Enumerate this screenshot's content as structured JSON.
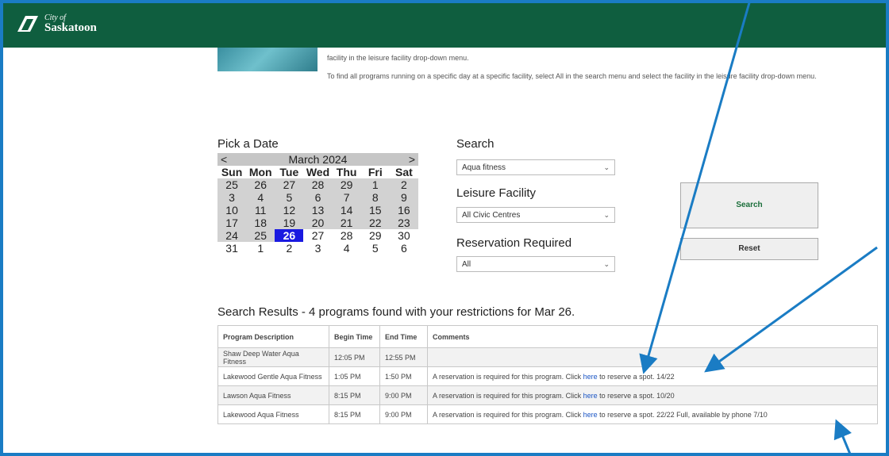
{
  "header": {
    "logo_small": "City of",
    "logo_big": "Saskatoon",
    "brand_color": "#0f5e3f"
  },
  "intro": {
    "line1": "facility in the leisure facility drop-down menu.",
    "line2": "To find all programs running on a specific day at a specific facility, select All in the search menu and select the facility in the leisure facility drop-down menu."
  },
  "calendar": {
    "title": "Pick a Date",
    "prev": "<",
    "next": ">",
    "month": "March 2024",
    "days": [
      "Sun",
      "Mon",
      "Tue",
      "Wed",
      "Thu",
      "Fri",
      "Sat"
    ],
    "weeks": [
      [
        "25",
        "26",
        "27",
        "28",
        "29",
        "1",
        "2"
      ],
      [
        "3",
        "4",
        "5",
        "6",
        "7",
        "8",
        "9"
      ],
      [
        "10",
        "11",
        "12",
        "13",
        "14",
        "15",
        "16"
      ],
      [
        "17",
        "18",
        "19",
        "20",
        "21",
        "22",
        "23"
      ],
      [
        "24",
        "25",
        "26",
        "27",
        "28",
        "29",
        "30"
      ],
      [
        "31",
        "1",
        "2",
        "3",
        "4",
        "5",
        "6"
      ]
    ],
    "selected": "26"
  },
  "search": {
    "search_label": "Search",
    "search_value": "Aqua fitness",
    "facility_label": "Leisure Facility",
    "facility_value": "All Civic Centres",
    "reservation_label": "Reservation Required",
    "reservation_value": "All",
    "search_button": "Search",
    "reset_button": "Reset"
  },
  "results": {
    "title": "Search Results - 4 programs found with your restrictions for Mar 26.",
    "headers": [
      "Program Description",
      "Begin Time",
      "End Time",
      "Comments"
    ],
    "rows": [
      {
        "program": "Shaw Deep Water Aqua Fitness",
        "begin": "12:05 PM",
        "end": "12:55 PM",
        "pre": "",
        "link": "",
        "post": ""
      },
      {
        "program": "Lakewood Gentle Aqua Fitness",
        "begin": "1:05 PM",
        "end": "1:50 PM",
        "pre": "A reservation is required for this program. Click",
        "link": "here",
        "post": "to reserve a spot. 14/22"
      },
      {
        "program": "Lawson Aqua Fitness",
        "begin": "8:15 PM",
        "end": "9:00 PM",
        "pre": "A reservation is required for this program. Click",
        "link": "here",
        "post": "to reserve a spot. 10/20"
      },
      {
        "program": "Lakewood Aqua Fitness",
        "begin": "8:15 PM",
        "end": "9:00 PM",
        "pre": "A reservation is required for this program. Click",
        "link": "here",
        "post": "to reserve a spot. 22/22 Full, available by phone 7/10"
      }
    ]
  },
  "annotation_color": "#1a7cc4"
}
